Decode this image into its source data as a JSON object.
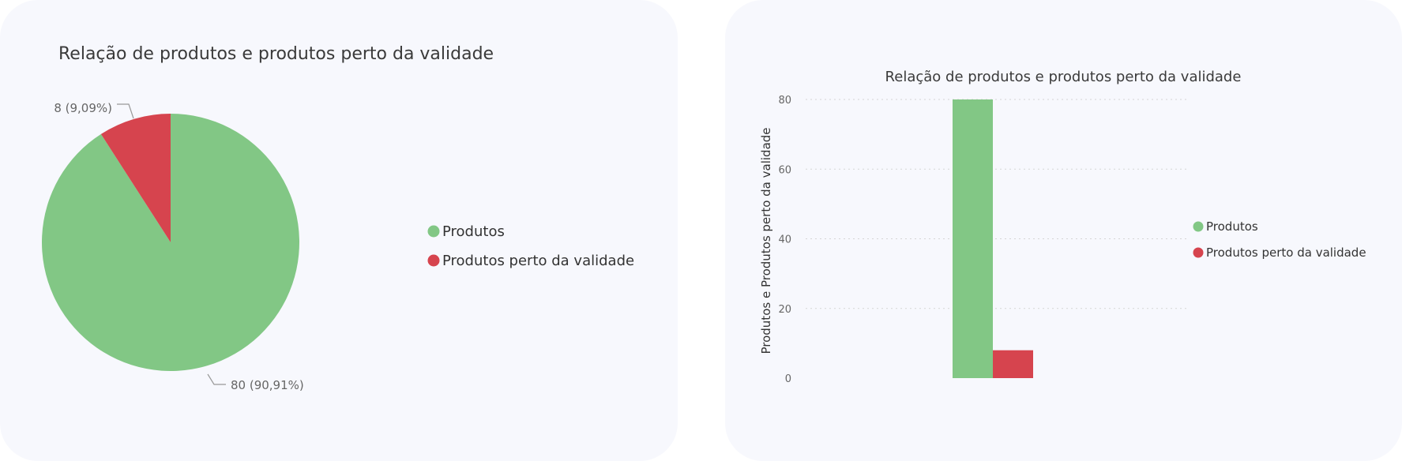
{
  "chart_data": [
    {
      "type": "pie",
      "title": "Relação de produtos e produtos perto da validade",
      "series": [
        {
          "name": "Produtos",
          "value": 80,
          "label": "80 (90,91%)",
          "color": "#82c785"
        },
        {
          "name": "Produtos perto da validade",
          "value": 8,
          "label": "8 (9,09%)",
          "color": "#d6444e"
        }
      ],
      "legend_position": "right"
    },
    {
      "type": "bar",
      "title": "Relação de produtos e produtos perto da validade",
      "ylabel": "Produtos e Produtos perto da validade",
      "ylim": [
        0,
        80
      ],
      "yticks": [
        "0",
        "20",
        "40",
        "60",
        "80"
      ],
      "grid": true,
      "series": [
        {
          "name": "Produtos",
          "value": 80,
          "color": "#82c785"
        },
        {
          "name": "Produtos perto da validade",
          "value": 8,
          "color": "#d6444e"
        }
      ],
      "legend_position": "right"
    }
  ]
}
